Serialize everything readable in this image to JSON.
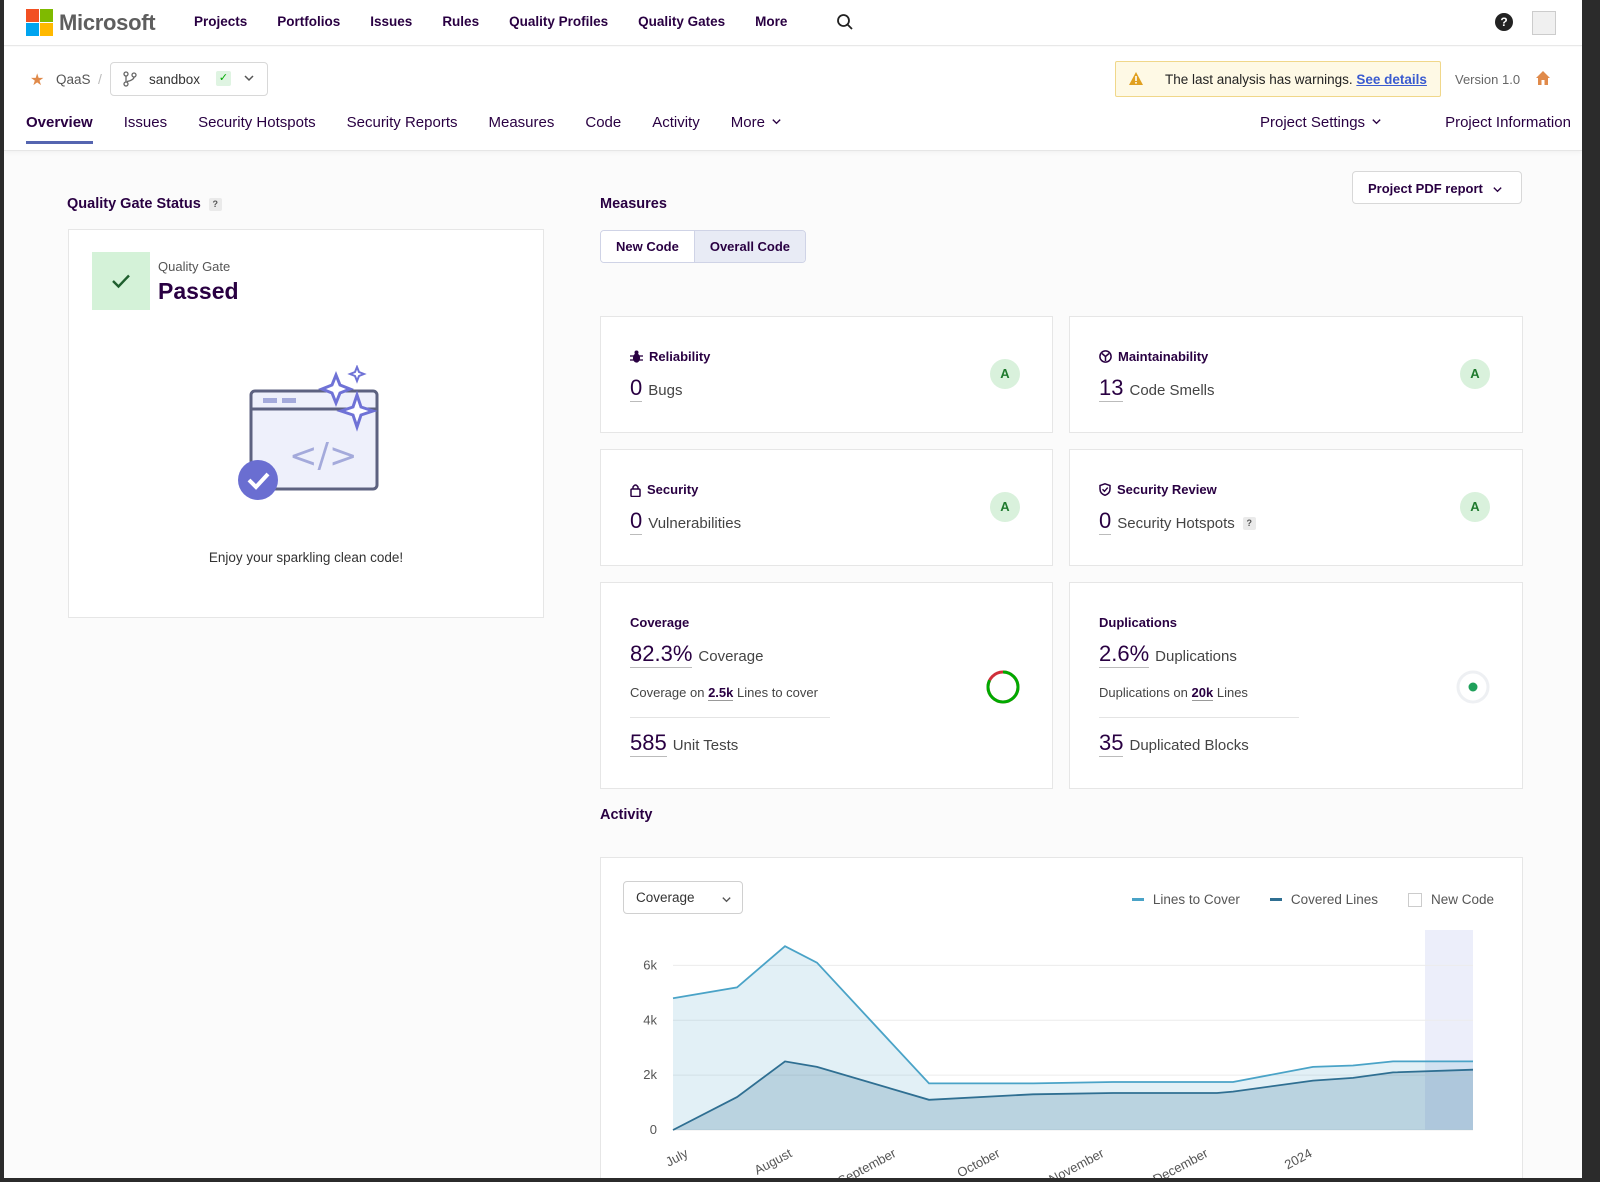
{
  "brand": {
    "name": "Microsoft",
    "colors": [
      "#f25022",
      "#7fba00",
      "#00a4ef",
      "#ffb900"
    ]
  },
  "topnav": {
    "links": [
      "Projects",
      "Portfolios",
      "Issues",
      "Rules",
      "Quality Profiles",
      "Quality Gates",
      "More"
    ],
    "help": "?"
  },
  "project": {
    "name": "QaaS",
    "branch": "sandbox",
    "warning_text": "The last analysis has warnings.",
    "warning_link": "See details",
    "version": "Version 1.0"
  },
  "tabs": [
    "Overview",
    "Issues",
    "Security Hotspots",
    "Security Reports",
    "Measures",
    "Code",
    "Activity",
    "More"
  ],
  "tabs_right": [
    "Project Settings",
    "Project Information"
  ],
  "quality_gate": {
    "section_title": "Quality Gate Status",
    "label": "Quality Gate",
    "status": "Passed",
    "message": "Enjoy your sparkling clean code!"
  },
  "measures": {
    "title": "Measures",
    "pdf_button": "Project PDF report",
    "toggle": [
      "New Code",
      "Overall Code"
    ],
    "reliability": {
      "title": "Reliability",
      "value": "0",
      "unit": "Bugs",
      "grade": "A"
    },
    "maintainability": {
      "title": "Maintainability",
      "value": "13",
      "unit": "Code Smells",
      "grade": "A"
    },
    "security": {
      "title": "Security",
      "value": "0",
      "unit": "Vulnerabilities",
      "grade": "A"
    },
    "security_review": {
      "title": "Security Review",
      "value": "0",
      "unit": "Security Hotspots",
      "grade": "A"
    },
    "coverage": {
      "title": "Coverage",
      "value": "82.3%",
      "unit": "Coverage",
      "sub_prefix": "Coverage on",
      "sub_value": "2.5k",
      "sub_suffix": "Lines to cover",
      "tests_value": "585",
      "tests_unit": "Unit Tests",
      "percent": 82.3
    },
    "duplications": {
      "title": "Duplications",
      "value": "2.6%",
      "unit": "Duplications",
      "sub_prefix": "Duplications on",
      "sub_value": "20k",
      "sub_suffix": "Lines",
      "blocks_value": "35",
      "blocks_unit": "Duplicated Blocks"
    }
  },
  "activity": {
    "title": "Activity",
    "select": "Coverage",
    "legend": [
      "Lines to Cover",
      "Covered Lines",
      "New Code"
    ]
  },
  "chart_data": {
    "type": "area",
    "yticks": [
      "6k",
      "4k",
      "2k",
      "0"
    ],
    "ylim": [
      0,
      7000
    ],
    "xticks": [
      "July",
      "August",
      "September",
      "October",
      "November",
      "December",
      "2024"
    ],
    "series": [
      {
        "name": "Lines to Cover",
        "color": "#4aa3c7",
        "values": [
          4800,
          5200,
          6700,
          6100,
          1700,
          1700,
          1750,
          1750,
          1750,
          2300,
          2350,
          2500,
          2500
        ]
      },
      {
        "name": "Covered Lines",
        "color": "#2f6f92",
        "values": [
          0,
          1200,
          2500,
          2300,
          1100,
          1300,
          1350,
          1350,
          1400,
          1800,
          1900,
          2100,
          2200
        ]
      }
    ],
    "x": [
      0,
      0.08,
      0.14,
      0.18,
      0.32,
      0.45,
      0.55,
      0.68,
      0.7,
      0.8,
      0.85,
      0.9,
      1.0
    ]
  }
}
